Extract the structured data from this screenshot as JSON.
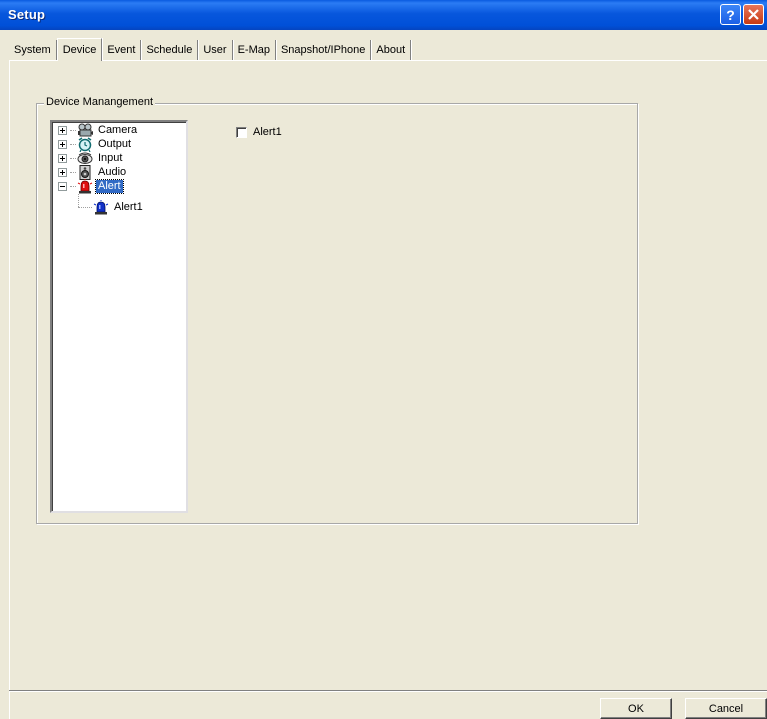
{
  "window": {
    "title": "Setup",
    "help_label": "?",
    "close_label": "X"
  },
  "tabs": [
    {
      "label": "System"
    },
    {
      "label": "Device",
      "active": true
    },
    {
      "label": "Event"
    },
    {
      "label": "Schedule"
    },
    {
      "label": "User"
    },
    {
      "label": "E-Map"
    },
    {
      "label": "Snapshot/IPhone"
    },
    {
      "label": "About"
    }
  ],
  "group": {
    "label": "Device Manangement"
  },
  "tree": {
    "nodes": [
      {
        "label": "Camera",
        "icon": "camera-icon",
        "expander": "plus"
      },
      {
        "label": "Output",
        "icon": "alarm-clock-icon",
        "expander": "plus"
      },
      {
        "label": "Input",
        "icon": "eye-icon",
        "expander": "plus"
      },
      {
        "label": "Audio",
        "icon": "speaker-icon",
        "expander": "plus"
      },
      {
        "label": "Alert",
        "icon": "siren-icon",
        "expander": "minus",
        "selected": true
      },
      {
        "label": "Alert1",
        "icon": "siren-blue-icon",
        "child": true
      }
    ]
  },
  "checkbox": {
    "label": "Alert1",
    "checked": false
  },
  "buttons": {
    "ok": "OK",
    "cancel": "Cancel"
  },
  "colors": {
    "titlebar": "#0054e3",
    "background": "#ece9d8",
    "selection": "#316ac5"
  }
}
